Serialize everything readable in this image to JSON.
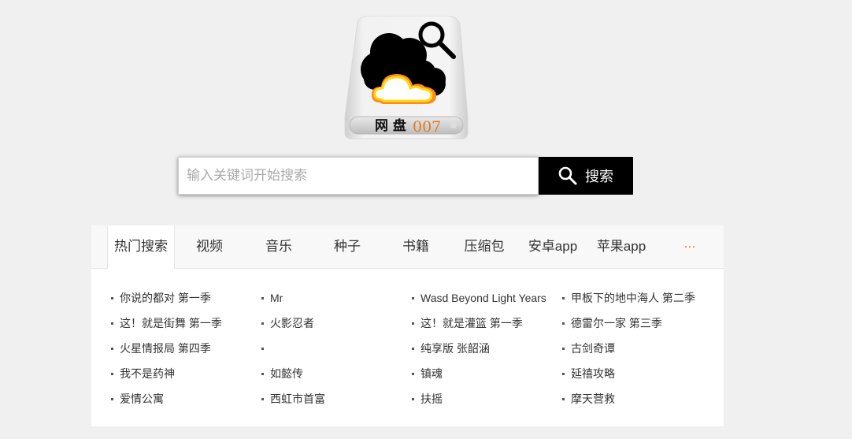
{
  "logo": {
    "text_cn": "网 盘",
    "text_num": "007",
    "num_color": "#e8761a"
  },
  "search": {
    "placeholder": "输入关键词开始搜索",
    "value": "",
    "button_label": "搜索",
    "button_icon": "search-icon"
  },
  "tabs": [
    {
      "label": "热门搜索",
      "active": true
    },
    {
      "label": "视频"
    },
    {
      "label": "音乐"
    },
    {
      "label": "种子"
    },
    {
      "label": "书籍"
    },
    {
      "label": "压缩包"
    },
    {
      "label": "安卓app"
    },
    {
      "label": "苹果app"
    },
    {
      "label": "···"
    }
  ],
  "hot": {
    "columns": [
      [
        "你说的都对 第一季",
        "这！就是街舞 第一季",
        "火星情报局 第四季",
        "我不是药神",
        "爱情公寓"
      ],
      [
        "Mr",
        "火影忍者",
        "",
        "如懿传",
        "西虹市首富"
      ],
      [
        "Wasd Beyond Light Years",
        "这！就是灌篮 第一季",
        "纯享版 张韶涵",
        "镇魂",
        "扶摇"
      ],
      [
        "甲板下的地中海人 第二季",
        "德雷尔一家 第三季",
        "古剑奇谭",
        "延禧攻略",
        "摩天营救"
      ]
    ]
  }
}
